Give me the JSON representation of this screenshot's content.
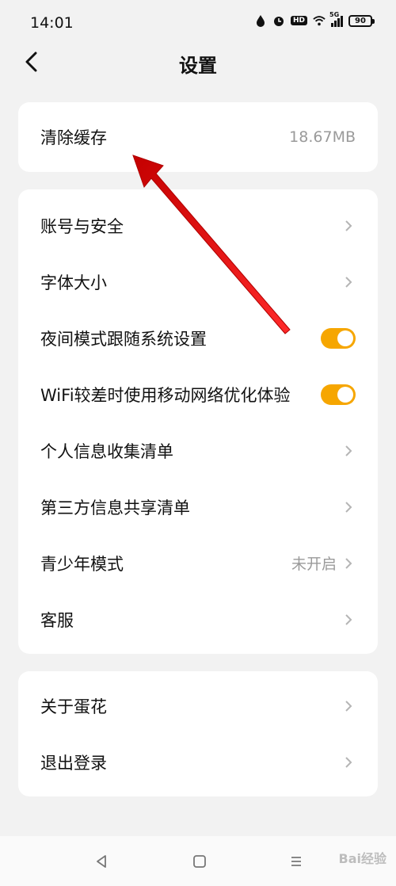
{
  "status": {
    "time": "14:01",
    "hd": "HD",
    "network": "5G",
    "battery": "90"
  },
  "header": {
    "title": "设置"
  },
  "cache": {
    "label": "清除缓存",
    "value": "18.67MB"
  },
  "settings": {
    "items": [
      {
        "label": "账号与安全"
      },
      {
        "label": "字体大小"
      },
      {
        "label": "夜间模式跟随系统设置",
        "toggle": true
      },
      {
        "label": "WiFi较差时使用移动网络优化体验",
        "toggle": true
      },
      {
        "label": "个人信息收集清单"
      },
      {
        "label": "第三方信息共享清单"
      },
      {
        "label": "青少年模式",
        "value": "未开启"
      },
      {
        "label": "客服"
      }
    ]
  },
  "about": {
    "items": [
      {
        "label": "关于蛋花"
      },
      {
        "label": "退出登录"
      }
    ]
  },
  "colors": {
    "accent": "#f6a600",
    "arrow": "#e02020",
    "background": "#f2f2f2"
  },
  "watermark": "Bai经验"
}
